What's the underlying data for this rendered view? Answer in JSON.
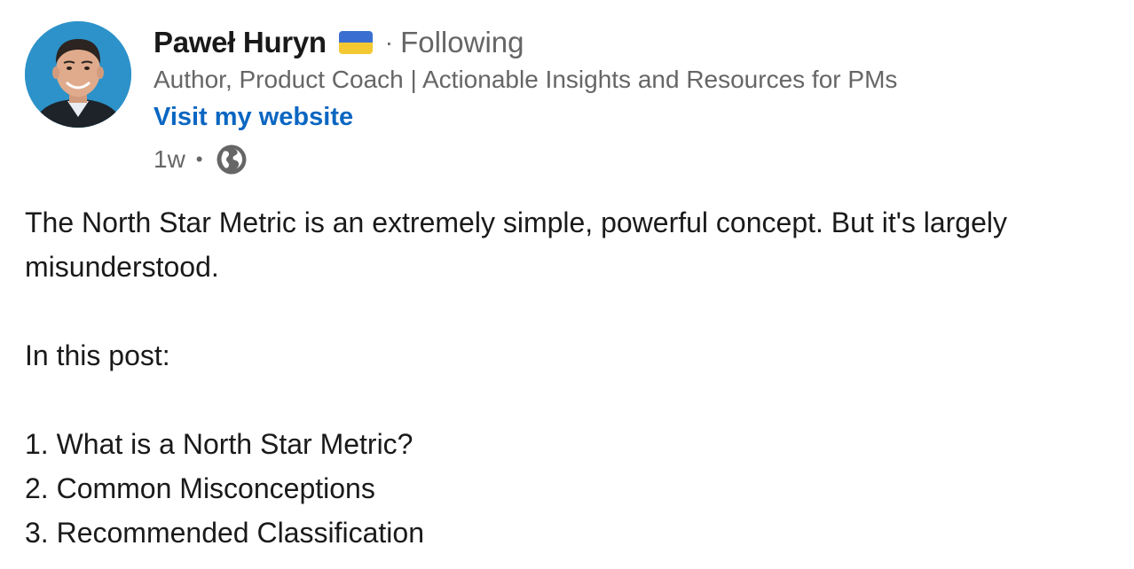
{
  "author": {
    "name": "Paweł Huryn",
    "flag_icon": "ukraine-flag-icon",
    "follow_status": "Following",
    "headline": "Author, Product Coach | Actionable Insights and Resources for PMs",
    "website_link": "Visit my website",
    "time_ago": "1w",
    "visibility_icon": "globe-icon"
  },
  "post": {
    "paragraph_1": "The North Star Metric is an extremely simple, powerful concept. But it's largely misunderstood.",
    "paragraph_2": "In this post:",
    "list_items": [
      "1. What is a North Star Metric?",
      "2. Common Misconceptions",
      "3. Recommended Classification"
    ]
  },
  "colors": {
    "link": "#0a66c2",
    "secondary_text": "#666666",
    "avatar_background": "#2d92c9",
    "flag_blue": "#3a6fd1",
    "flag_yellow": "#f3c831"
  }
}
